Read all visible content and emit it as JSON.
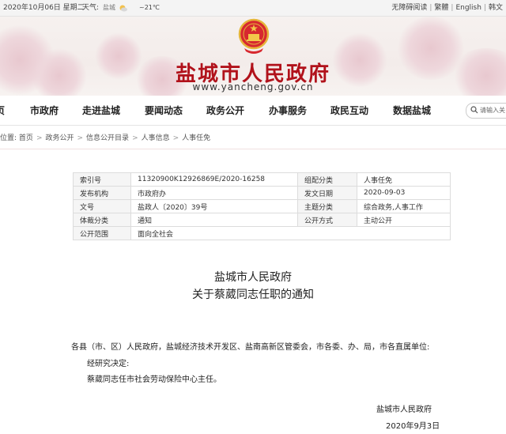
{
  "topbar": {
    "date": "2020年10月06日 星期二",
    "weather_label": "天气:",
    "city": "盐城",
    "temp": "~21℃",
    "links": [
      "无障碍阅读",
      "繁體",
      "English",
      "韩文"
    ]
  },
  "header": {
    "title": "盐城市人民政府",
    "url": "www.yancheng.gov.cn"
  },
  "nav": {
    "items": [
      "页",
      "市政府",
      "走进盐城",
      "要闻动态",
      "政务公开",
      "办事服务",
      "政民互动",
      "数据盐城"
    ],
    "search_placeholder": "请输入关"
  },
  "breadcrumb": {
    "label": "位置:",
    "items": [
      "首页",
      "政务公开",
      "信息公开目录",
      "人事信息",
      "人事任免"
    ]
  },
  "info": {
    "rows": [
      {
        "k1": "索引号",
        "v1": "11320900K12926869E/2020-16258",
        "k2": "组配分类",
        "v2": "人事任免"
      },
      {
        "k1": "发布机构",
        "v1": "市政府办",
        "k2": "发文日期",
        "v2": "2020-09-03"
      },
      {
        "k1": "文号",
        "v1": "盐政人〔2020〕39号",
        "k2": "主题分类",
        "v2": "综合政务,人事工作"
      },
      {
        "k1": "体裁分类",
        "v1": "通知",
        "k2": "公开方式",
        "v2": "主动公开"
      },
      {
        "k1": "公开范围",
        "v1": "面向全社会"
      }
    ]
  },
  "article": {
    "title1": "盐城市人民政府",
    "title2": "关于蔡葳同志任职的通知",
    "addressee": "各县（市、区）人民政府，盐城经济技术开发区、盐南高新区管委会，市各委、办、局，市各直属单位:",
    "line1": "经研究决定:",
    "line2": "蔡葳同志任市社会劳动保险中心主任。",
    "signature": "盐城市人民政府",
    "date": "2020年9月3日"
  },
  "colors": {
    "title_red": "#b1121b",
    "header_bg": "#f4eeec"
  }
}
